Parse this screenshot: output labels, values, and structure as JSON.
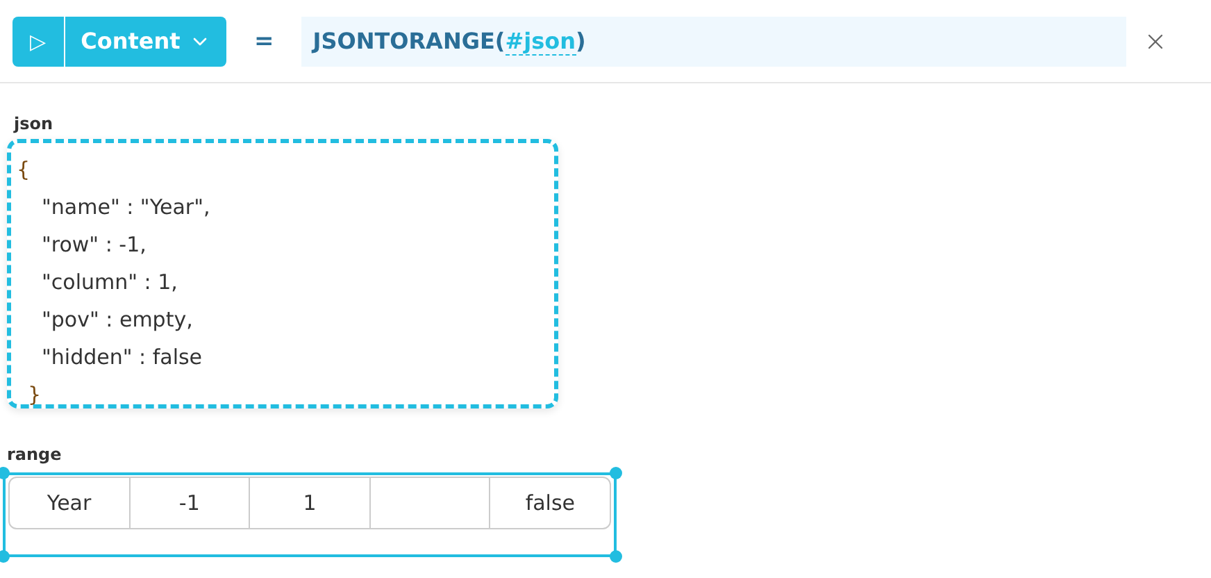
{
  "toolbar": {
    "run_icon": "▷",
    "mode": "Content",
    "equals": "=",
    "formula": {
      "function": "JSONTORANGE(",
      "argument": "#json",
      "closing": ")"
    }
  },
  "json_field": {
    "label": "json",
    "lines": [
      {
        "kind": "brace",
        "text": "{"
      },
      {
        "kind": "entry",
        "text": "\"name\" : \"Year\","
      },
      {
        "kind": "entry",
        "text": "\"row\" : -1,"
      },
      {
        "kind": "entry",
        "text": "\"column\" : 1,"
      },
      {
        "kind": "entry",
        "text": "\"pov\" : empty,"
      },
      {
        "kind": "entry",
        "text": "\"hidden\" : false"
      },
      {
        "kind": "brace",
        "text": "}"
      }
    ]
  },
  "range": {
    "label": "range",
    "selected": true,
    "cells": [
      {
        "text": "Year"
      },
      {
        "text": "-1"
      },
      {
        "text": "1"
      },
      {},
      {
        "text": "false"
      }
    ]
  }
}
